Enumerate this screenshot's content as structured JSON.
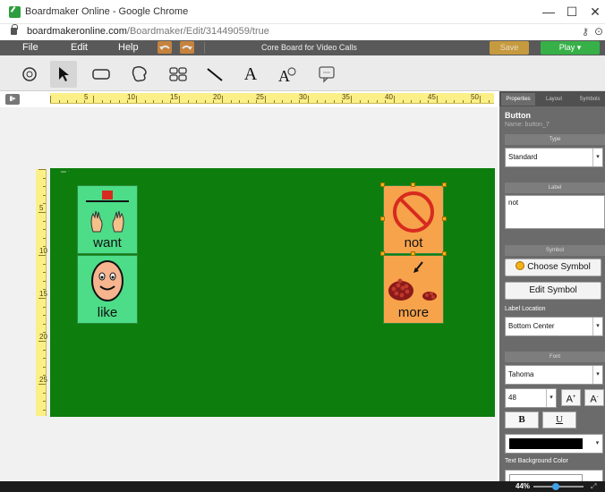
{
  "window": {
    "title": "Boardmaker Online - Google Chrome",
    "controls": {
      "minimize": "—",
      "maximize": "☐",
      "close": "✕"
    }
  },
  "address": {
    "host": "boardmakeronline.com",
    "path": "/Boardmaker/Edit/31449059/true"
  },
  "menu": {
    "items": [
      "File",
      "Edit",
      "Help"
    ],
    "doc_title": "Core Board for Video Calls",
    "save_label": "Save",
    "play_label": "Play ▾"
  },
  "toolbar": {
    "tools": [
      "symbolate-tool",
      "select-tool",
      "button-tool",
      "freeform-tool",
      "symbol-button-tool",
      "line-tool",
      "text-tool",
      "symbolate-text-tool",
      "speech-bubble-tool"
    ],
    "text_tool_glyph": "A"
  },
  "ruler": {
    "h_labels": [
      "5",
      "10",
      "15",
      "20",
      "25",
      "30",
      "35",
      "40",
      "45",
      "50"
    ],
    "v_labels": [
      "5",
      "10",
      "15",
      "20",
      "25"
    ]
  },
  "board": {
    "cells": [
      {
        "label": "want",
        "color": "#4ddc88",
        "symbol": "want-hands-icon"
      },
      {
        "label": "like",
        "color": "#4ddc88",
        "symbol": "like-face-icon"
      },
      {
        "label": "not",
        "color": "#f7a34b",
        "symbol": "not-prohibited-icon"
      },
      {
        "label": "more",
        "color": "#f7a34b",
        "symbol": "more-beans-icon"
      }
    ]
  },
  "properties": {
    "tabs": [
      "Properties",
      "Layout",
      "Symbols"
    ],
    "heading": "Button",
    "name_line": "Name: button_7",
    "type_header": "Type",
    "type_value": "Standard",
    "label_header": "Label",
    "label_value": "not",
    "symbol_header": "Symbol",
    "choose_symbol": "Choose Symbol",
    "edit_symbol": "Edit Symbol",
    "label_location_title": "Label Location",
    "label_location_value": "Bottom Center",
    "font_header": "Font",
    "font_value": "Tahoma",
    "font_size": "48",
    "bold": "B",
    "underline": "U",
    "text_bg_title": "Text Background Color",
    "font_color": "#000000"
  },
  "status": {
    "zoom": "44%",
    "zoom_level": 0.44
  }
}
